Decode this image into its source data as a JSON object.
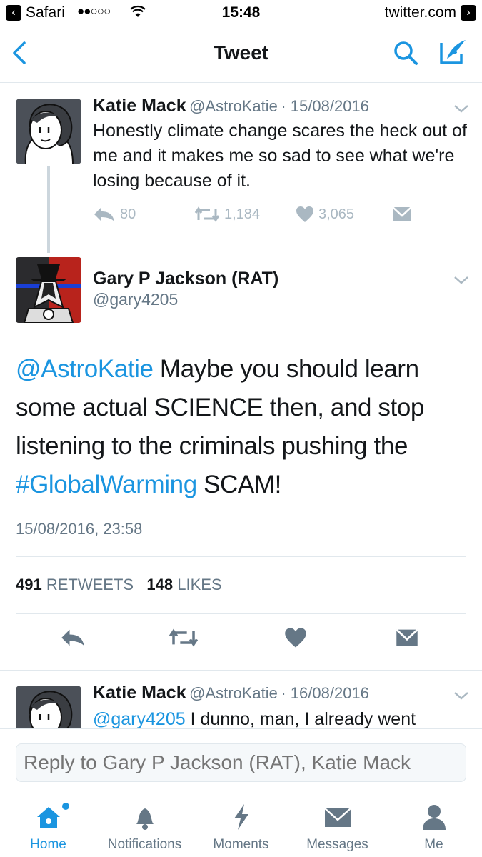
{
  "status_bar": {
    "back_app": "Safari",
    "signal": "●●○○○",
    "time": "15:48",
    "domain": "twitter.com"
  },
  "nav": {
    "title": "Tweet"
  },
  "parent_tweet": {
    "name": "Katie Mack",
    "handle": "@AstroKatie",
    "date": "· 15/08/2016",
    "text": "Honestly climate change scares the heck out of me and it makes me so sad to see what we're losing because of it.",
    "replies": "80",
    "retweets": "1,184",
    "likes": "3,065"
  },
  "main_tweet": {
    "name": "Gary P Jackson (RAT)",
    "handle": "@gary4205",
    "mention": "@AstroKatie",
    "text_part1": " Maybe you should learn some actual SCIENCE then, and stop listening to the criminals pushing the ",
    "hashtag": "#GlobalWarming",
    "text_part2": " SCAM!",
    "timestamp": "15/08/2016, 23:58",
    "retweet_count": "491",
    "retweet_label": "RETWEETS",
    "like_count": "148",
    "like_label": "LIKES"
  },
  "reply_tweet": {
    "name": "Katie Mack",
    "handle": "@AstroKatie",
    "date": "· 16/08/2016",
    "mention": "@gary4205",
    "text": " I dunno, man, I already went"
  },
  "reply_bar": {
    "placeholder": "Reply to Gary P Jackson (RAT), Katie Mack"
  },
  "tabs": [
    {
      "label": "Home",
      "icon": "home-icon",
      "active": true
    },
    {
      "label": "Notifications",
      "icon": "bell-icon"
    },
    {
      "label": "Moments",
      "icon": "lightning-icon"
    },
    {
      "label": "Messages",
      "icon": "envelope-icon"
    },
    {
      "label": "Me",
      "icon": "person-icon"
    }
  ],
  "colors": {
    "accent": "#1b95e0",
    "muted": "#657786",
    "icon_gray": "#aab8c2"
  }
}
